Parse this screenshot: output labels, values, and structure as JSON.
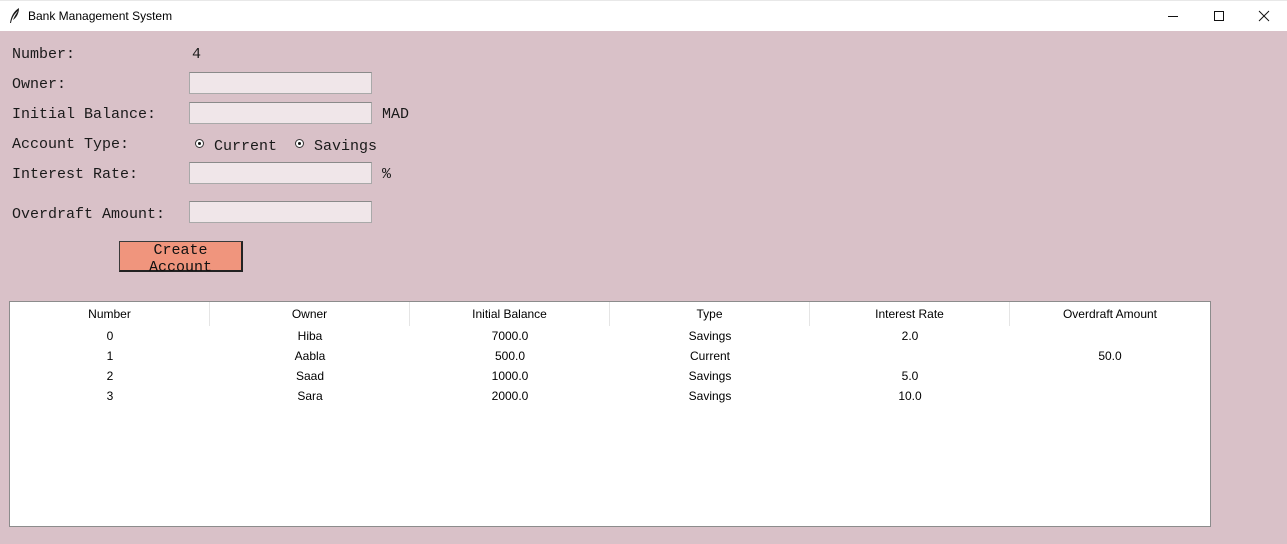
{
  "window": {
    "title": "Bank Management System",
    "icon": "feather-icon"
  },
  "form": {
    "number_label": "Number:",
    "number_value": "4",
    "owner_label": "Owner:",
    "owner_value": "",
    "balance_label": "Initial Balance:",
    "balance_value": "",
    "currency": "MAD",
    "type_label": "Account Type:",
    "type_options": [
      "Current",
      "Savings"
    ],
    "interest_label": "Interest Rate:",
    "interest_value": "",
    "percent_sign": "%",
    "overdraft_label": "Overdraft Amount:",
    "overdraft_value": "",
    "create_button": "Create Account"
  },
  "table": {
    "columns": [
      "Number",
      "Owner",
      "Initial Balance",
      "Type",
      "Interest Rate",
      "Overdraft Amount"
    ],
    "rows": [
      [
        "0",
        "Hiba",
        "7000.0",
        "Savings",
        "2.0",
        ""
      ],
      [
        "1",
        "Aabla",
        "500.0",
        "Current",
        "",
        "50.0"
      ],
      [
        "2",
        "Saad",
        "1000.0",
        "Savings",
        "5.0",
        ""
      ],
      [
        "3",
        "Sara",
        "2000.0",
        "Savings",
        "10.0",
        ""
      ]
    ]
  },
  "colors": {
    "background": "#d9c1c8",
    "button": "#f0957d",
    "entry": "#f0e6e9"
  }
}
